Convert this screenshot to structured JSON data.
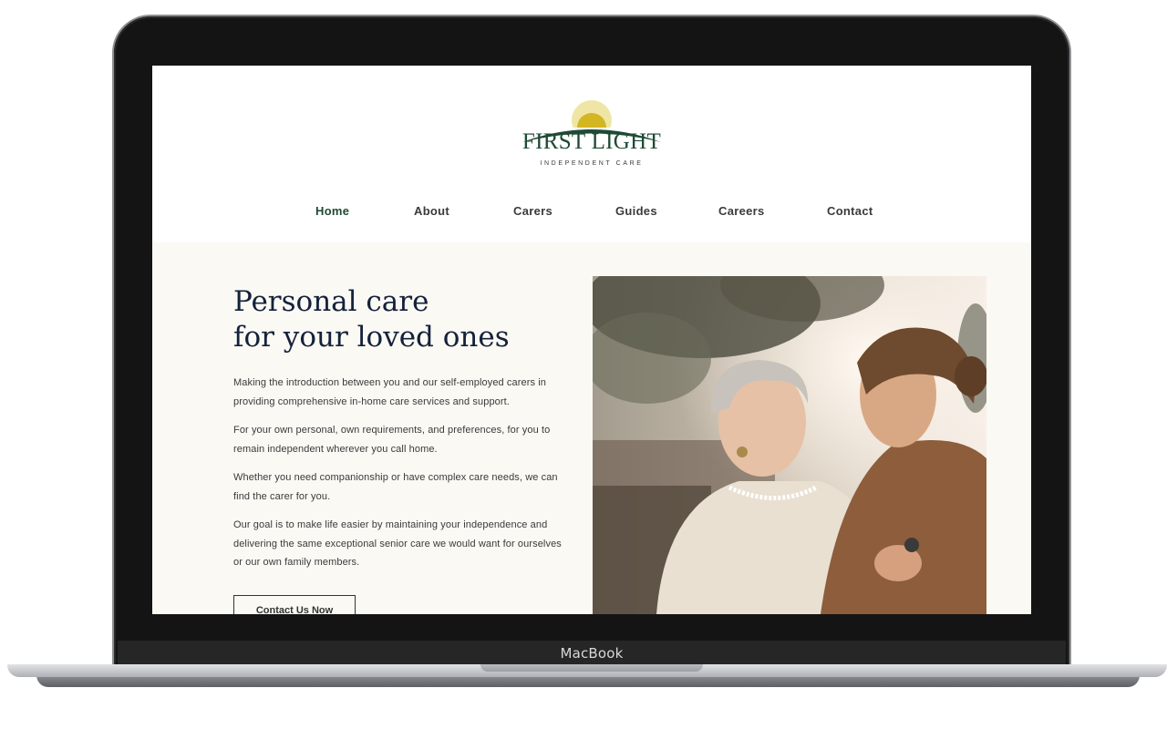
{
  "device": {
    "brand_label": "MacBook"
  },
  "logo": {
    "title": "FIRST LIGHT",
    "subtitle": "INDEPENDENT CARE"
  },
  "nav": {
    "items": [
      {
        "label": "Home",
        "active": true
      },
      {
        "label": "About",
        "active": false
      },
      {
        "label": "Carers",
        "active": false
      },
      {
        "label": "Guides",
        "active": false
      },
      {
        "label": "Careers",
        "active": false
      },
      {
        "label": "Contact",
        "active": false
      }
    ]
  },
  "hero": {
    "title_line1": "Personal care",
    "title_line2": "for your loved ones",
    "paragraphs": [
      [
        "Making the introduction between you and our self-employed carers in",
        "providing comprehensive in-home care services and support."
      ],
      [
        "For your own personal, own requirements, and preferences, for you to",
        "remain independent wherever you call home."
      ],
      [
        "Whether you need companionship or have complex care needs, we can",
        "find the carer for you."
      ],
      [
        "Our goal is to make life easier by maintaining your independence and",
        "delivering the same exceptional senior care we would want for ourselves",
        "or our own family members."
      ]
    ],
    "cta_label": "Contact Us Now"
  },
  "colors": {
    "brand_green": "#1f4a34",
    "sun_yellow": "#d4b623",
    "navy": "#14213a",
    "hero_bg": "#faf9f4"
  }
}
